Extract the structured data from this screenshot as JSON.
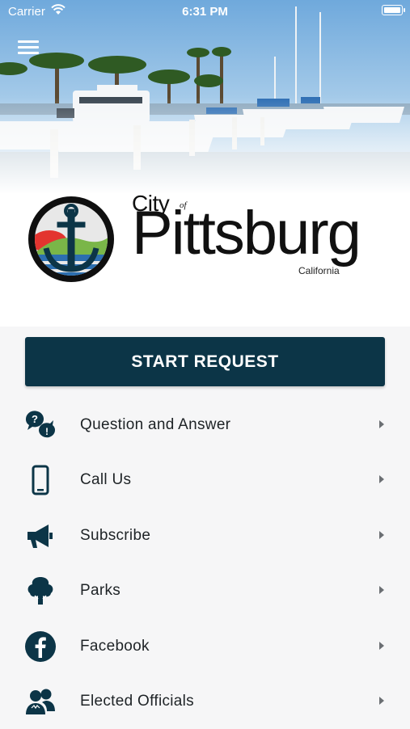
{
  "status_bar": {
    "carrier": "Carrier",
    "time": "6:31 PM"
  },
  "brand": {
    "city": "City",
    "of": "of",
    "name": "Pittsburg",
    "state": "California"
  },
  "start_request": {
    "label": "START REQUEST"
  },
  "menu": {
    "items": [
      {
        "label": "Question and Answer",
        "icon": "question-answer-icon"
      },
      {
        "label": "Call Us",
        "icon": "phone-icon"
      },
      {
        "label": "Subscribe",
        "icon": "megaphone-icon"
      },
      {
        "label": "Parks",
        "icon": "tree-icon"
      },
      {
        "label": "Facebook",
        "icon": "facebook-icon"
      },
      {
        "label": "Elected Officials",
        "icon": "people-icon"
      }
    ]
  },
  "colors": {
    "primary": "#0c3547",
    "background": "#f6f6f7",
    "chevron": "#6b6f73"
  }
}
